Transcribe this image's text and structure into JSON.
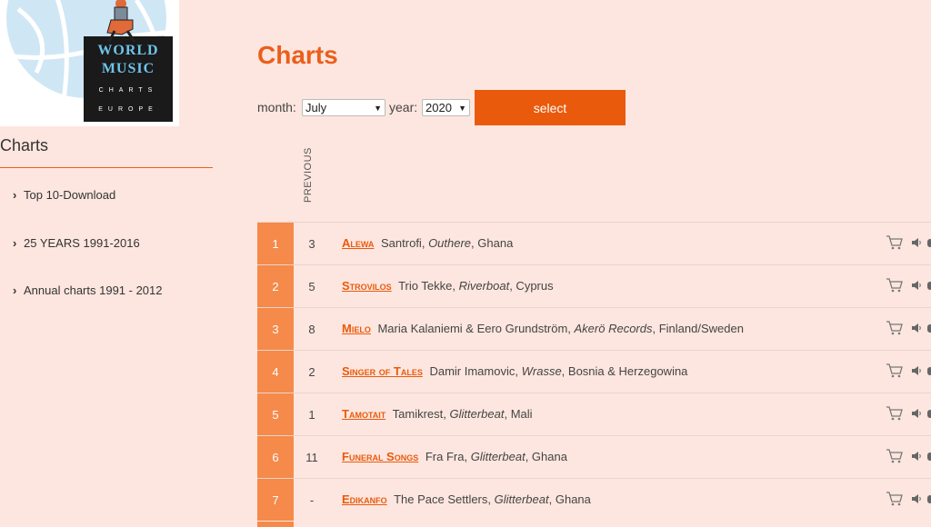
{
  "logo": {
    "line1": "WORLD",
    "line2": "MUSIC",
    "line3": "CHARTS",
    "line4": "EUROPE"
  },
  "sidebar": {
    "title": "Charts",
    "items": [
      {
        "label": "Top 10-Download"
      },
      {
        "label": "25 YEARS 1991-2016"
      },
      {
        "label": "Annual charts 1991 - 2012"
      }
    ]
  },
  "main": {
    "title": "Charts",
    "month_label": "month:",
    "month_value": "July",
    "year_label": "year:",
    "year_value": "2020",
    "select_button": "select",
    "previous_header": "PREVIOUS"
  },
  "chart": {
    "rows": [
      {
        "rank": "1",
        "previous": "3",
        "title": "Alewa",
        "artist": "Santrofi,",
        "label": "Outhere",
        "country": ", Ghana"
      },
      {
        "rank": "2",
        "previous": "5",
        "title": "Strovilos",
        "artist": "Trio Tekke,",
        "label": "Riverboat",
        "country": ", Cyprus"
      },
      {
        "rank": "3",
        "previous": "8",
        "title": "Mielo",
        "artist": "Maria Kalaniemi & Eero Grundström,",
        "label": "Akerö Records",
        "country": ", Finland/Sweden"
      },
      {
        "rank": "4",
        "previous": "2",
        "title": "Singer of Tales",
        "artist": "Damir Imamovic,",
        "label": "Wrasse",
        "country": ", Bosnia & Herzegowina"
      },
      {
        "rank": "5",
        "previous": "1",
        "title": "Tamotait",
        "artist": "Tamikrest,",
        "label": "Glitterbeat",
        "country": ", Mali"
      },
      {
        "rank": "6",
        "previous": "11",
        "title": "Funeral Songs",
        "artist": "Fra Fra,",
        "label": "Glitterbeat",
        "country": ", Ghana"
      },
      {
        "rank": "7",
        "previous": "-",
        "title": "Edikanfo",
        "artist": "The Pace Settlers,",
        "label": "Glitterbeat",
        "country": ", Ghana"
      }
    ]
  },
  "colors": {
    "accent": "#ea5a0c",
    "rank_bg": "#f58a4a",
    "page_bg": "#fde6df"
  },
  "icons": {
    "cart": "shopping-cart-icon",
    "speaker": "speaker-icon"
  }
}
